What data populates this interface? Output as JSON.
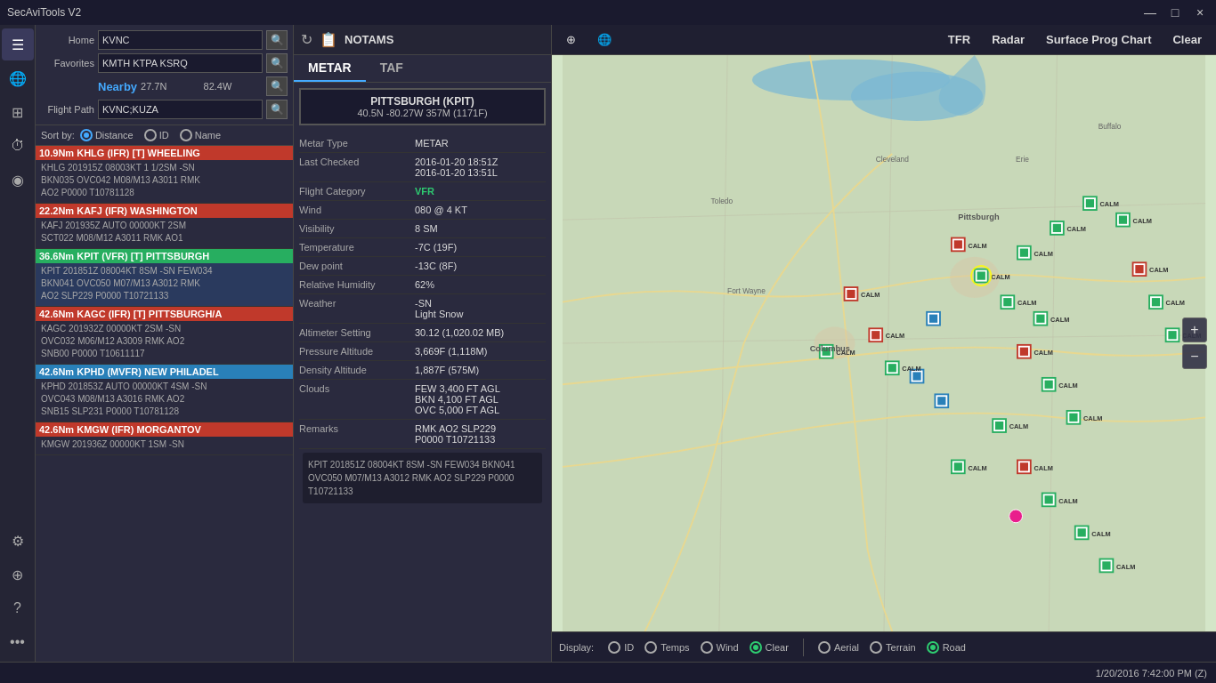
{
  "app": {
    "title": "SecAviTools V2",
    "win_controls": [
      "—",
      "□",
      "×"
    ]
  },
  "sidebar_icons": [
    {
      "name": "menu-icon",
      "symbol": "☰"
    },
    {
      "name": "globe-icon",
      "symbol": "🌐"
    },
    {
      "name": "calculator-icon",
      "symbol": "⊞"
    },
    {
      "name": "clock-icon",
      "symbol": "⏱"
    },
    {
      "name": "location-icon",
      "symbol": "◉"
    },
    {
      "name": "settings-icon",
      "symbol": "⚙"
    },
    {
      "name": "network-icon",
      "symbol": "⊕"
    },
    {
      "name": "help-icon",
      "symbol": "?"
    },
    {
      "name": "more-icon",
      "symbol": "•••"
    }
  ],
  "controls": {
    "home_label": "Home",
    "home_value": "KVNC",
    "home_placeholder": "KVNC",
    "favorites_label": "Favorites",
    "favorites_value": "KMTH KTPA KSRQ",
    "nearby_label": "Nearby",
    "nearby_lat": "27.7N",
    "nearby_lon": "82.4W",
    "flightpath_label": "Flight Path",
    "flightpath_value": "KVNC;KUZA",
    "sortby_label": "Sort by:",
    "sort_options": [
      {
        "id": "distance",
        "label": "Distance",
        "checked": true
      },
      {
        "id": "id",
        "label": "ID",
        "checked": false
      },
      {
        "id": "name",
        "label": "Name",
        "checked": false
      }
    ]
  },
  "list_items": [
    {
      "distance": "10.9Nm KHLG (IFR)  [T]  WHEELING",
      "category": "ifr",
      "body": "KHLG 201915Z 08003KT 1 1/2SM -SN\nBKN035 OVC042 M08/M13 A3011 RMK\nAO2 P0000 T10781128"
    },
    {
      "distance": "22.2Nm KAFJ (IFR)  WASHINGTON",
      "category": "ifr",
      "body": "KAFJ 201935Z AUTO 00000KT 2SM\nSCT022 M08/M12 A3011 RMK AO1"
    },
    {
      "distance": "36.6Nm KPIT (VFR)  [T]  PITTSBURGH",
      "category": "vfr",
      "body": "KPIT 201851Z 08004KT 8SM -SN FEW034\nBKN041 OVC050 M07/M13 A3012 RMK\nAO2 SLP229 P0000 T10721133"
    },
    {
      "distance": "42.6Nm KAGC (IFR)  [T]  PITTSBURGH/A",
      "category": "ifr",
      "body": "KAGC 201932Z 00000KT 2SM -SN\nOVC032 M06/M12 A3009 RMK AO2\nSNB00 P0000 T10611117"
    },
    {
      "distance": "42.6Nm KPHD (MVFR)  NEW PHILADEL",
      "category": "mvfr",
      "body": "KPHD 201853Z AUTO 00000KT 4SM -SN\nOVC043 M08/M13 A3016 RMK AO2\nSNB15 SLP231 P0000 T10781128"
    },
    {
      "distance": "42.6Nm KMGW (IFR)  MORGANTOV",
      "category": "ifr",
      "body": "KMGW 201936Z 00000KT 1SM -SN"
    }
  ],
  "notams": {
    "label": "NOTAMS",
    "refresh_icon": "↻",
    "brief_icon": "📋"
  },
  "tabs": [
    {
      "id": "metar",
      "label": "METAR",
      "active": true
    },
    {
      "id": "taf",
      "label": "TAF",
      "active": false
    }
  ],
  "station": {
    "name": "PITTSBURGH (KPIT)",
    "coords": "40.5N -80.27W 357M (1171F)"
  },
  "metar_details": [
    {
      "label": "Metar Type",
      "value": "METAR",
      "class": ""
    },
    {
      "label": "Last Checked",
      "value": "2016-01-20 18:51Z\n2016-01-20 13:51L",
      "class": ""
    },
    {
      "label": "Flight Category",
      "value": "VFR",
      "class": "green"
    },
    {
      "label": "Wind",
      "value": "080 @ 4 KT",
      "class": ""
    },
    {
      "label": "Visibility",
      "value": "8 SM",
      "class": ""
    },
    {
      "label": "Temperature",
      "value": "-7C (19F)",
      "class": ""
    },
    {
      "label": "Dew point",
      "value": "-13C (8F)",
      "class": ""
    },
    {
      "label": "Relative Humidity",
      "value": "62%",
      "class": ""
    },
    {
      "label": "Weather",
      "value": "-SN\nLight Snow",
      "class": ""
    },
    {
      "label": "Altimeter Setting",
      "value": "30.12 (1,020.02 MB)",
      "class": ""
    },
    {
      "label": "Pressure Altitude",
      "value": "3,669F (1,118M)",
      "class": ""
    },
    {
      "label": "Density Altitude",
      "value": "1,887F (575M)",
      "class": ""
    },
    {
      "label": "Clouds",
      "value": "FEW 3,400 FT AGL\nBKN 4,100 FT AGL\nOVC 5,000 FT AGL",
      "class": ""
    },
    {
      "label": "Remarks",
      "value": "RMK AO2 SLP229\nP0000 T10721133",
      "class": ""
    }
  ],
  "raw_metar": "KPIT 201851Z 08004KT 8SM -SN FEW034 BKN041 OVC050 M07/M13 A3012 RMK AO2 SLP229 P0000 T10721133",
  "map_toolbar": {
    "cross_icon": "⊕",
    "globe_icon": "🌐",
    "tfr_label": "TFR",
    "radar_label": "Radar",
    "surface_prog_label": "Surface Prog Chart",
    "clear_label": "Clear"
  },
  "map_display": {
    "label": "Display:",
    "options": [
      {
        "id": "id",
        "label": "ID",
        "checked": false,
        "color": "default"
      },
      {
        "id": "temps",
        "label": "Temps",
        "checked": false,
        "color": "default"
      },
      {
        "id": "wind",
        "label": "Wind",
        "checked": false,
        "color": "default"
      },
      {
        "id": "clear",
        "label": "Clear",
        "checked": true,
        "color": "green"
      }
    ],
    "view_options": [
      {
        "id": "aerial",
        "label": "Aerial",
        "checked": false,
        "color": "default"
      },
      {
        "id": "terrain",
        "label": "Terrain",
        "checked": false,
        "color": "default"
      },
      {
        "id": "road",
        "label": "Road",
        "checked": true,
        "color": "green"
      }
    ]
  },
  "map_markers": [
    {
      "label": "CALM",
      "x": 62,
      "y": 18,
      "color": "#27ae60"
    },
    {
      "label": "CALM",
      "x": 78,
      "y": 24,
      "color": "#27ae60"
    },
    {
      "label": "CALM",
      "x": 74,
      "y": 36,
      "color": "#27ae60"
    },
    {
      "label": "CALM",
      "x": 85,
      "y": 42,
      "color": "#27ae60"
    },
    {
      "label": "CALM",
      "x": 55,
      "y": 48,
      "color": "#c0392b"
    },
    {
      "label": "CALM",
      "x": 60,
      "y": 55,
      "color": "#27ae60"
    },
    {
      "label": "CALM",
      "x": 70,
      "y": 58,
      "color": "#c0392b"
    },
    {
      "label": "CALM",
      "x": 75,
      "y": 52,
      "color": "#27ae60"
    },
    {
      "label": "CALM",
      "x": 80,
      "y": 60,
      "color": "#27ae60"
    },
    {
      "label": "CALM",
      "x": 65,
      "y": 65,
      "color": "#2980b9"
    },
    {
      "label": "CALM",
      "x": 72,
      "y": 72,
      "color": "#c0392b"
    }
  ],
  "statusbar": {
    "datetime": "1/20/2016 7:42:00 PM (Z)"
  }
}
